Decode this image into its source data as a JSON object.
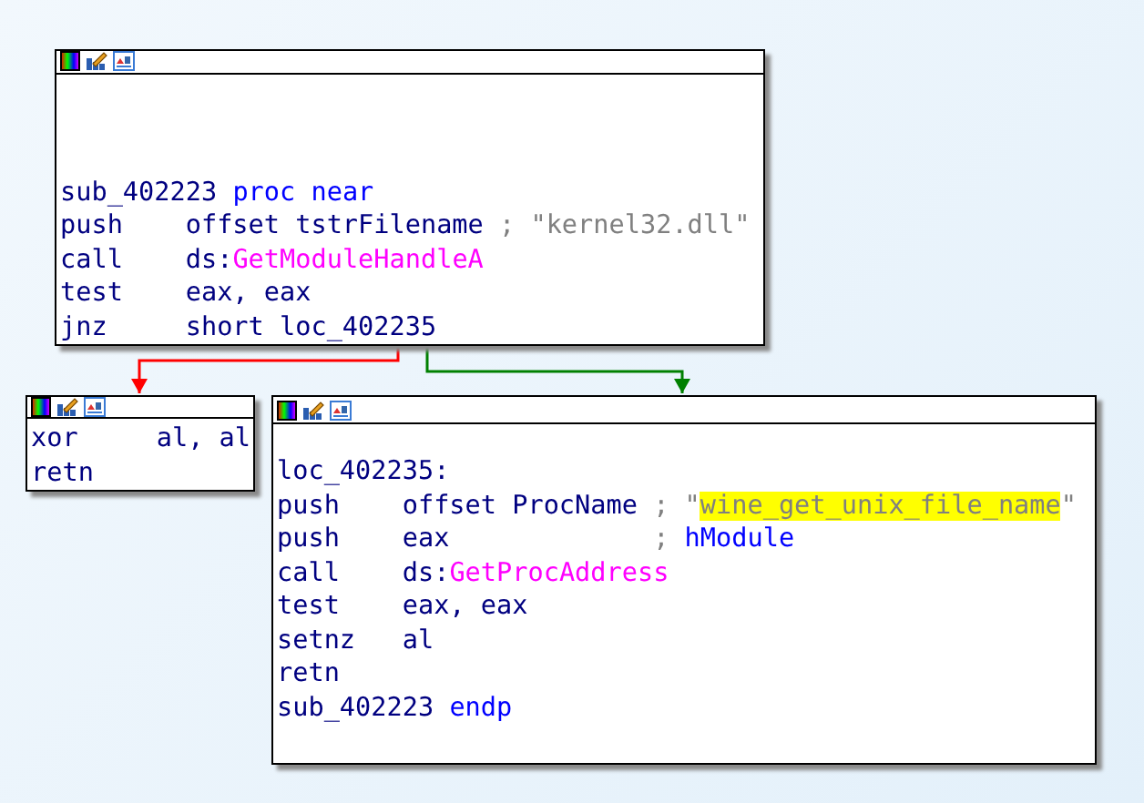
{
  "nodes": [
    {
      "lines": [
        {
          "kind": "label",
          "tokens": [
            {
              "text": "sub_402223 ",
              "kind": "name"
            },
            {
              "text": "proc near",
              "kind": "keyword"
            }
          ]
        },
        {
          "kind": "insn",
          "mnemonic": "push",
          "operands": [
            {
              "text": "offset tstrFilename",
              "kind": "name"
            }
          ],
          "comment": [
            {
              "text": "; \"",
              "kind": "comment"
            },
            {
              "text": "kernel32.dll",
              "kind": "comment",
              "highlighted": false
            },
            {
              "text": "\"",
              "kind": "comment"
            }
          ]
        },
        {
          "kind": "insn",
          "mnemonic": "call",
          "operands": [
            {
              "text": "ds:",
              "kind": "name"
            },
            {
              "text": "GetModuleHandleA",
              "kind": "import"
            }
          ]
        },
        {
          "kind": "insn",
          "mnemonic": "test",
          "operands": [
            {
              "text": "eax, eax",
              "kind": "name"
            }
          ]
        },
        {
          "kind": "insn",
          "mnemonic": "jnz",
          "operands": [
            {
              "text": "short loc_402235",
              "kind": "name"
            }
          ]
        }
      ]
    },
    {
      "lines": [
        {
          "kind": "insn",
          "mnemonic": "xor",
          "operands": [
            {
              "text": "al, al",
              "kind": "name"
            }
          ]
        },
        {
          "kind": "insn",
          "mnemonic": "retn"
        }
      ]
    },
    {
      "lines": [
        {
          "kind": "label",
          "tokens": [
            {
              "text": "loc_402235:",
              "kind": "name"
            }
          ]
        },
        {
          "kind": "insn",
          "mnemonic": "push",
          "operands": [
            {
              "text": "offset ProcName",
              "kind": "name"
            }
          ],
          "comment": [
            {
              "text": "; \"",
              "kind": "comment"
            },
            {
              "text": "wine_get_unix_file_name",
              "kind": "comment",
              "highlighted": true
            },
            {
              "text": "\"",
              "kind": "comment"
            }
          ]
        },
        {
          "kind": "insn",
          "mnemonic": "push",
          "operands": [
            {
              "text": "eax",
              "kind": "name"
            }
          ],
          "comment": [
            {
              "text": "; ",
              "kind": "comment"
            },
            {
              "text": "hModule",
              "kind": "keyword"
            }
          ]
        },
        {
          "kind": "insn",
          "mnemonic": "call",
          "operands": [
            {
              "text": "ds:",
              "kind": "name"
            },
            {
              "text": "GetProcAddress",
              "kind": "import"
            }
          ]
        },
        {
          "kind": "insn",
          "mnemonic": "test",
          "operands": [
            {
              "text": "eax, eax",
              "kind": "name"
            }
          ]
        },
        {
          "kind": "insn",
          "mnemonic": "setnz",
          "operands": [
            {
              "text": "al",
              "kind": "name"
            }
          ]
        },
        {
          "kind": "insn",
          "mnemonic": "retn"
        },
        {
          "kind": "label",
          "tokens": [
            {
              "text": "sub_402223 ",
              "kind": "name"
            },
            {
              "text": "endp",
              "kind": "keyword"
            }
          ]
        }
      ]
    }
  ],
  "edges": [
    {
      "color": "#ff0000"
    },
    {
      "color": "#008000"
    }
  ]
}
